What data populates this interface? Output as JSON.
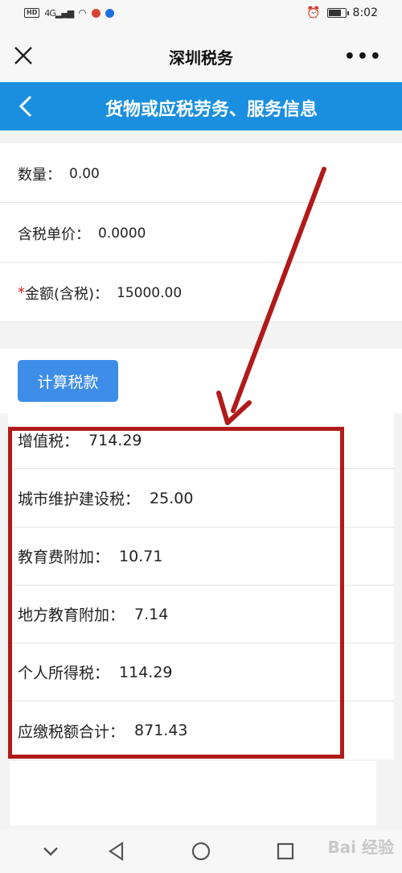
{
  "status_bar": {
    "left_badges": [
      "HD",
      "4G"
    ],
    "time": "8:02"
  },
  "wechat_bar": {
    "title": "深圳税务"
  },
  "header": {
    "title": "货物或应税劳务、服务信息"
  },
  "form": {
    "quantity_label": "数量：",
    "quantity_value": "0.00",
    "unit_price_label": "含税单价：",
    "unit_price_value": "0.0000",
    "amount_required_mark": "*",
    "amount_label": "金额(含税)：",
    "amount_value": "15000.00"
  },
  "calc_button": "计算税款",
  "results": [
    {
      "label": "增值税：",
      "value": "714.29"
    },
    {
      "label": "城市维护建设税：",
      "value": "25.00"
    },
    {
      "label": "教育费附加：",
      "value": "10.71"
    },
    {
      "label": "地方教育附加：",
      "value": "7.14"
    },
    {
      "label": "个人所得税：",
      "value": "114.29"
    },
    {
      "label": "应缴税额合计：",
      "value": "871.43"
    }
  ],
  "watermark": "Bai 经验",
  "colors": {
    "header_blue": "#1a8fe0",
    "button_blue": "#3d8de9",
    "highlight_red": "#b11a1a"
  }
}
